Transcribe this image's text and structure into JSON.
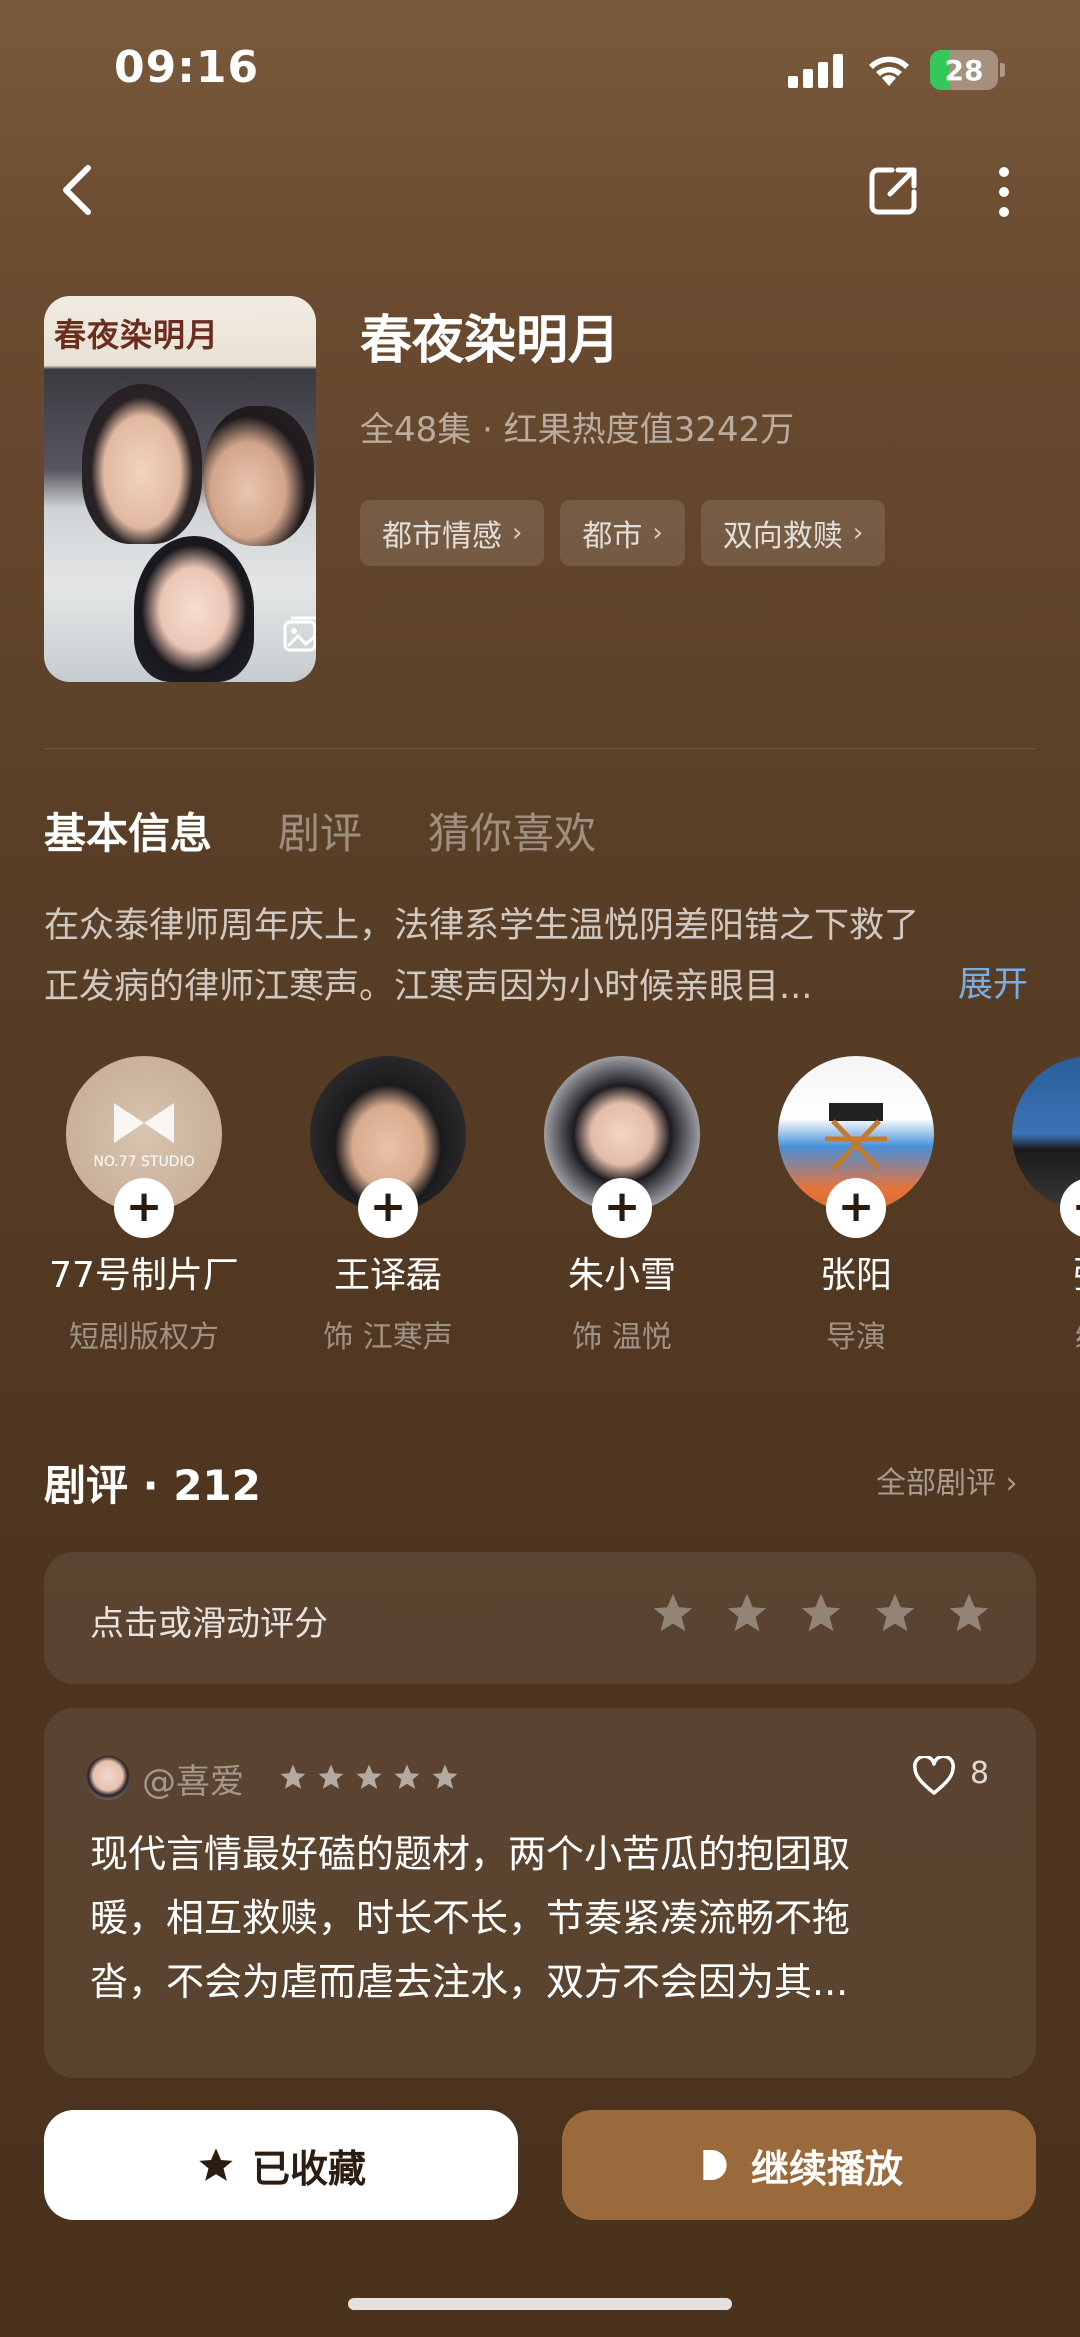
{
  "status_bar": {
    "time": "09:16",
    "battery": "28",
    "battery_level": 0.28
  },
  "nav": {
    "back_icon": "chevron-left-icon",
    "share_icon": "share-icon",
    "more_icon": "more-vertical-icon"
  },
  "drama": {
    "poster_title": "春夜染明月",
    "title": "春夜染明月",
    "meta": "全48集 · 红果热度值3242万",
    "tags": [
      {
        "label": "都市情感"
      },
      {
        "label": "都市"
      },
      {
        "label": "双向救赎"
      }
    ]
  },
  "tabs": [
    {
      "label": "基本信息",
      "active": true
    },
    {
      "label": "剧评",
      "active": false
    },
    {
      "label": "猜你喜欢",
      "active": false
    }
  ],
  "synopsis": {
    "line1": "在众泰律师周年庆上，法律系学生温悦阴差阳错之下救了",
    "line2": "正发病的律师江寒声。江寒声因为小时候亲眼目...",
    "expand_label": "展开"
  },
  "cast": [
    {
      "name": "77号制片厂",
      "role": "短剧版权方",
      "avatar_text": "NO.77 STUDIO"
    },
    {
      "name": "王译磊",
      "role": "饰 江寒声"
    },
    {
      "name": "朱小雪",
      "role": "饰 温悦"
    },
    {
      "name": "张阳",
      "role": "导演"
    },
    {
      "name": "张",
      "role": "编"
    }
  ],
  "reviews": {
    "title": "剧评 · 212",
    "all_label": "全部剧评",
    "rate_prompt": "点击或滑动评分",
    "rate_star_count": 5,
    "item": {
      "user": "@喜爱",
      "stars": 5,
      "likes": "8",
      "line1": "现代言情最好磕的题材，两个小苦瓜的抱团取",
      "line2": "暖，相互救赎，时长不长，节奏紧凑流畅不拖",
      "line3": "沓，不会为虐而虐去注水，双方不会因为其..."
    }
  },
  "actions": {
    "favorite_label": "已收藏",
    "play_label": "继续播放"
  },
  "colors": {
    "accent_link": "#78aee6",
    "play_button": "#9a6a3c",
    "battery_fill": "#34c759"
  }
}
